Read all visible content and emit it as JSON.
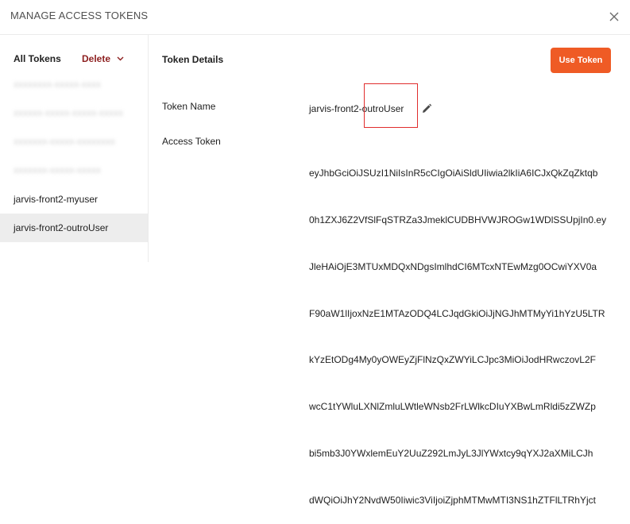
{
  "modal": {
    "title": "MANAGE ACCESS TOKENS",
    "close_icon": "close-icon"
  },
  "sidebar": {
    "all_tokens_label": "All Tokens",
    "delete_label": "Delete",
    "delete_icon": "chevron-down-icon",
    "items": [
      {
        "label": "jarvis-front2-myuser",
        "selected": false
      },
      {
        "label": "jarvis-front2-outroUser",
        "selected": true
      }
    ],
    "redacted_items": [
      {
        "label": "xxxxxxxx-xxxxx-xxxx"
      },
      {
        "label": "xxxxxx-xxxxx-xxxxx-xxxxx"
      },
      {
        "label": "xxxxxxx-xxxxx-xxxxxxxx"
      },
      {
        "label": "xxxxxxx-xxxxx-xxxxx"
      }
    ]
  },
  "details": {
    "section_title": "Token Details",
    "use_token_label": "Use Token",
    "token_name_label": "Token Name",
    "token_name_value": "jarvis-front2-outroUser",
    "edit_icon": "pencil-icon",
    "access_token_label": "Access Token",
    "access_token_lines": [
      "eyJhbGciOiJSUzI1NiIsInR5cCIgOiAiSldUIiwia2lkIiA6ICJxQkZqZktqb",
      "0h1ZXJ6Z2VfSlFqSTRZa3JmeklCUDBHVWJROGw1WDlSSUpjIn0.ey",
      "JleHAiOjE3MTUxMDQxNDgsImlhdCI6MTcxNTEwMzg0OCwiYXV0a",
      "F90aW1lIjoxNzE1MTAzODQ4LCJqdGkiOiJjNGJhMTMyYi1hYzU5LTR",
      "kYzEtODg4My0yOWEyZjFlNzQxZWYiLCJpc3MiOiJodHRwczovL2F",
      "wcC1tYWluLXNlZmluLWtleWNsb2FrLWlkcDIuYXBwLmRldi5zZWZp",
      "bi5mb3J0YWxlemEuY2UuZ292LmJyL3JlYWxtcy9qYXJ2aXMiLCJh",
      "dWQiOiJhY2NvdW50Iiwic3ViIjoiZjphMTMwMTI3NS1hZTFlLTRhYjct"
    ]
  },
  "colors": {
    "accent": "#ef5b25",
    "delete": "#8d1f1f",
    "highlight_outline": "#e02d2d",
    "selected_row": "#ededed"
  }
}
